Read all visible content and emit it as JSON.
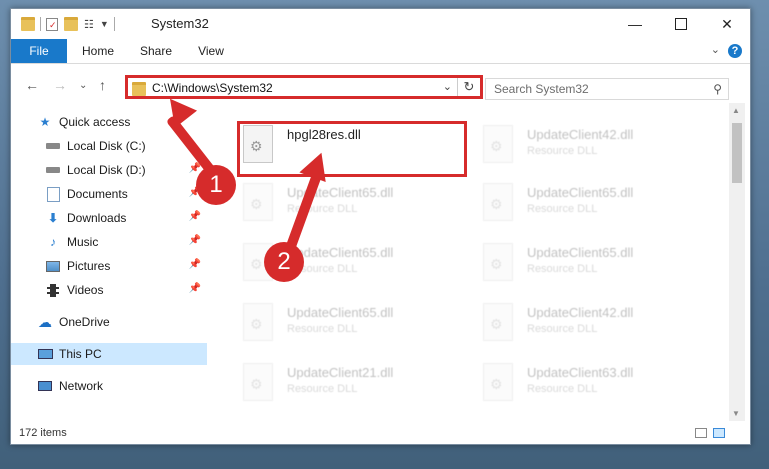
{
  "window": {
    "title": "System32"
  },
  "ribbon": {
    "tabs": [
      "File",
      "Home",
      "Share",
      "View"
    ]
  },
  "address": {
    "path": "C:\\Windows\\System32"
  },
  "search": {
    "placeholder": "Search System32"
  },
  "sidebar": {
    "items": [
      {
        "label": "Quick access",
        "icon": "star-icon"
      },
      {
        "label": "Local Disk (C:)",
        "icon": "drive-icon"
      },
      {
        "label": "Local Disk (D:)",
        "icon": "drive-icon"
      },
      {
        "label": "Documents",
        "icon": "documents-icon"
      },
      {
        "label": "Downloads",
        "icon": "download-icon"
      },
      {
        "label": "Music",
        "icon": "music-icon"
      },
      {
        "label": "Pictures",
        "icon": "pictures-icon"
      },
      {
        "label": "Videos",
        "icon": "videos-icon"
      },
      {
        "label": "OneDrive",
        "icon": "cloud-icon"
      },
      {
        "label": "This PC",
        "icon": "computer-icon"
      },
      {
        "label": "Network",
        "icon": "network-icon"
      }
    ]
  },
  "files": [
    {
      "name": "hpgl28res.dll",
      "type": ""
    },
    {
      "name": "UpdateClient42.dll",
      "type": "Resource DLL"
    },
    {
      "name": "UpdateClient65.dll",
      "type": "Resource DLL"
    },
    {
      "name": "UpdateClient65.dll",
      "type": "Resource DLL"
    },
    {
      "name": "UpdateClient65.dll",
      "type": "Resource DLL"
    },
    {
      "name": "UpdateClient65.dll",
      "type": "Resource DLL"
    },
    {
      "name": "UpdateClient65.dll",
      "type": "Resource DLL"
    },
    {
      "name": "UpdateClient42.dll",
      "type": "Resource DLL"
    },
    {
      "name": "UpdateClient21.dll",
      "type": "Resource DLL"
    },
    {
      "name": "UpdateClient63.dll",
      "type": "Resource DLL"
    }
  ],
  "status": {
    "count": "172 items"
  },
  "callouts": {
    "one": "1",
    "two": "2"
  },
  "colors": {
    "accent": "#1979ca",
    "callout": "#d62b2b",
    "selection": "#cce8ff"
  }
}
